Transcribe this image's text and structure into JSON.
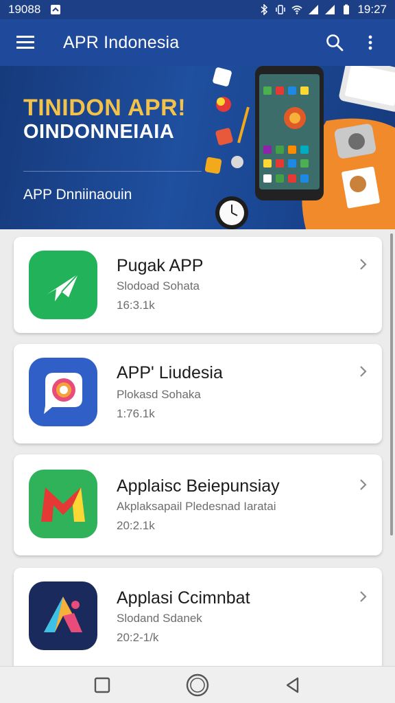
{
  "status_bar": {
    "time_left": "19088",
    "time_right": "19:27"
  },
  "app_bar": {
    "title": "APR Indonesia"
  },
  "hero": {
    "headline": "TINIDON APR!",
    "headline2": "OINDONNEIAIA",
    "subtitle": "APP Dnniinaouin"
  },
  "apps": [
    {
      "name": "Pugak APP",
      "desc": "Slodoad Sohata",
      "size": "16:3.1k"
    },
    {
      "name": "APP' Liudesia",
      "desc": "Plokasd Sohaka",
      "size": "1:76.1k"
    },
    {
      "name": "Applaisc Beiepunsiay",
      "desc": "Akplaksapail Pledesnad Iaratai",
      "size": "20:2.1k"
    },
    {
      "name": "Applasi Ccimnbat",
      "desc": "Slodand Sdanek",
      "size": "20:2-1/k"
    }
  ],
  "colors": {
    "app_bar": "#1f4a9b",
    "status_bar": "#1d3f86",
    "hero_accent": "#f2c24a",
    "icon_green": "#22b35a",
    "icon_blue": "#2f5fc7",
    "icon_dark": "#1a2a5c"
  }
}
